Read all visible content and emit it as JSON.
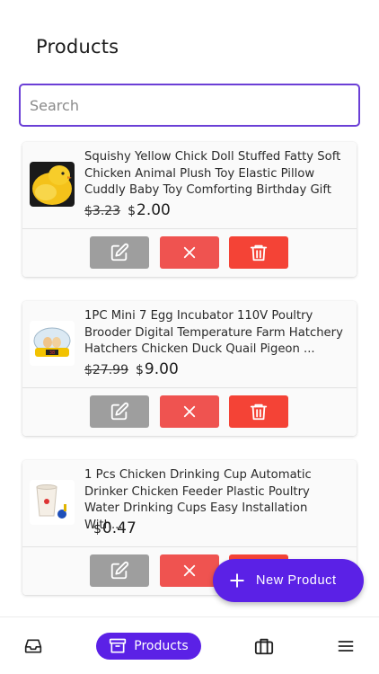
{
  "header": {
    "title": "Products"
  },
  "search": {
    "placeholder": "Search",
    "value": ""
  },
  "currency_symbol": "$",
  "products": [
    {
      "name": "Squishy Yellow Chick Doll Stuffed Fatty Soft Chicken Animal Plush Toy Elastic Pillow Cuddly Baby Toy Comforting Birthday Gift",
      "old_price": "$3.23",
      "price": "2.00"
    },
    {
      "name": "1PC Mini 7 Egg Incubator 110V Poultry Brooder Digital Temperature Farm Hatchery Hatchers Chicken Duck Quail  Pigeon ...",
      "old_price": "$27.99",
      "price": "9.00"
    },
    {
      "name": "1 Pcs Chicken Drinking Cup Automatic Drinker Chicken Feeder  Plastic Poultry Water Drinking Cups Easy Installation With...",
      "old_price": "",
      "price": "0.47"
    }
  ],
  "fab": {
    "label": "New Product"
  },
  "bottom_nav": {
    "active_label": "Products",
    "items": [
      "inbox-icon",
      "archive-icon",
      "briefcase-icon",
      "menu-icon"
    ]
  },
  "colors": {
    "accent": "#5b21e6",
    "search_border": "#6b3fd6",
    "edit": "#9e9e9e",
    "close": "#ef5350",
    "delete": "#f44336"
  }
}
